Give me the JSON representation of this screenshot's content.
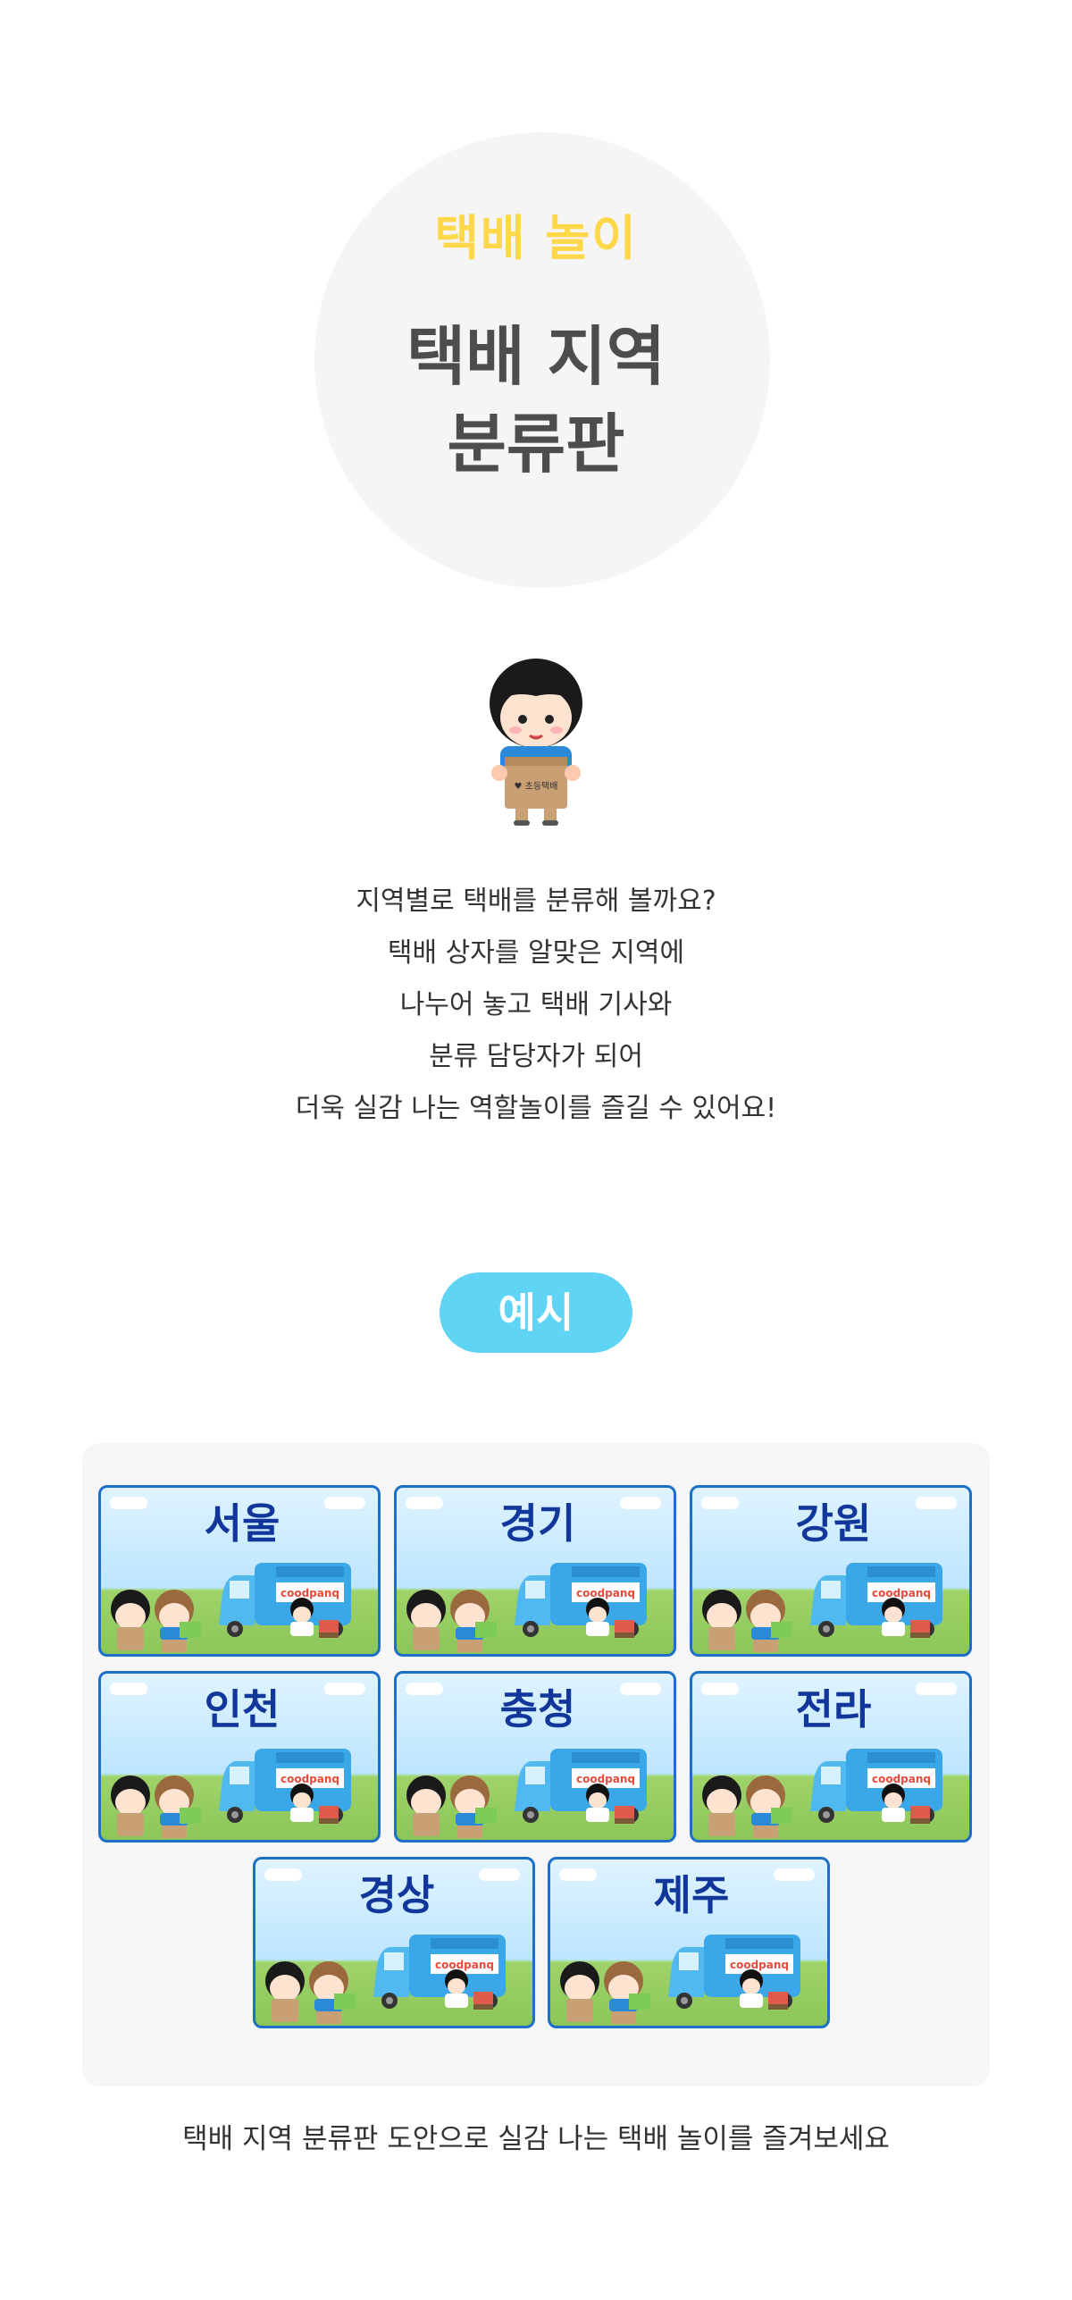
{
  "hero": {
    "subtitle": "택배 놀이",
    "title_line1": "택배 지역",
    "title_line2": "분류판"
  },
  "description": [
    "지역별로 택배를 분류해 볼까요?",
    "택배 상자를 알맞은 지역에",
    "나누어 놓고 택배 기사와",
    "분류 담당자가 되어",
    "더욱 실감 나는 역할놀이를 즐길 수 있어요!"
  ],
  "example_label": "예시",
  "regions": [
    "서울",
    "경기",
    "강원",
    "인천",
    "충청",
    "전라",
    "경상",
    "제주"
  ],
  "truck_brand": "coodpanq",
  "caption": "택배 지역 분류판 도안으로 실감 나는 택배 놀이를 즐겨보세요",
  "colors": {
    "accent": "#5fd4f5",
    "subtitle": "#ffd84a",
    "card_border": "#1d6fc7",
    "region_text": "#12379a"
  }
}
